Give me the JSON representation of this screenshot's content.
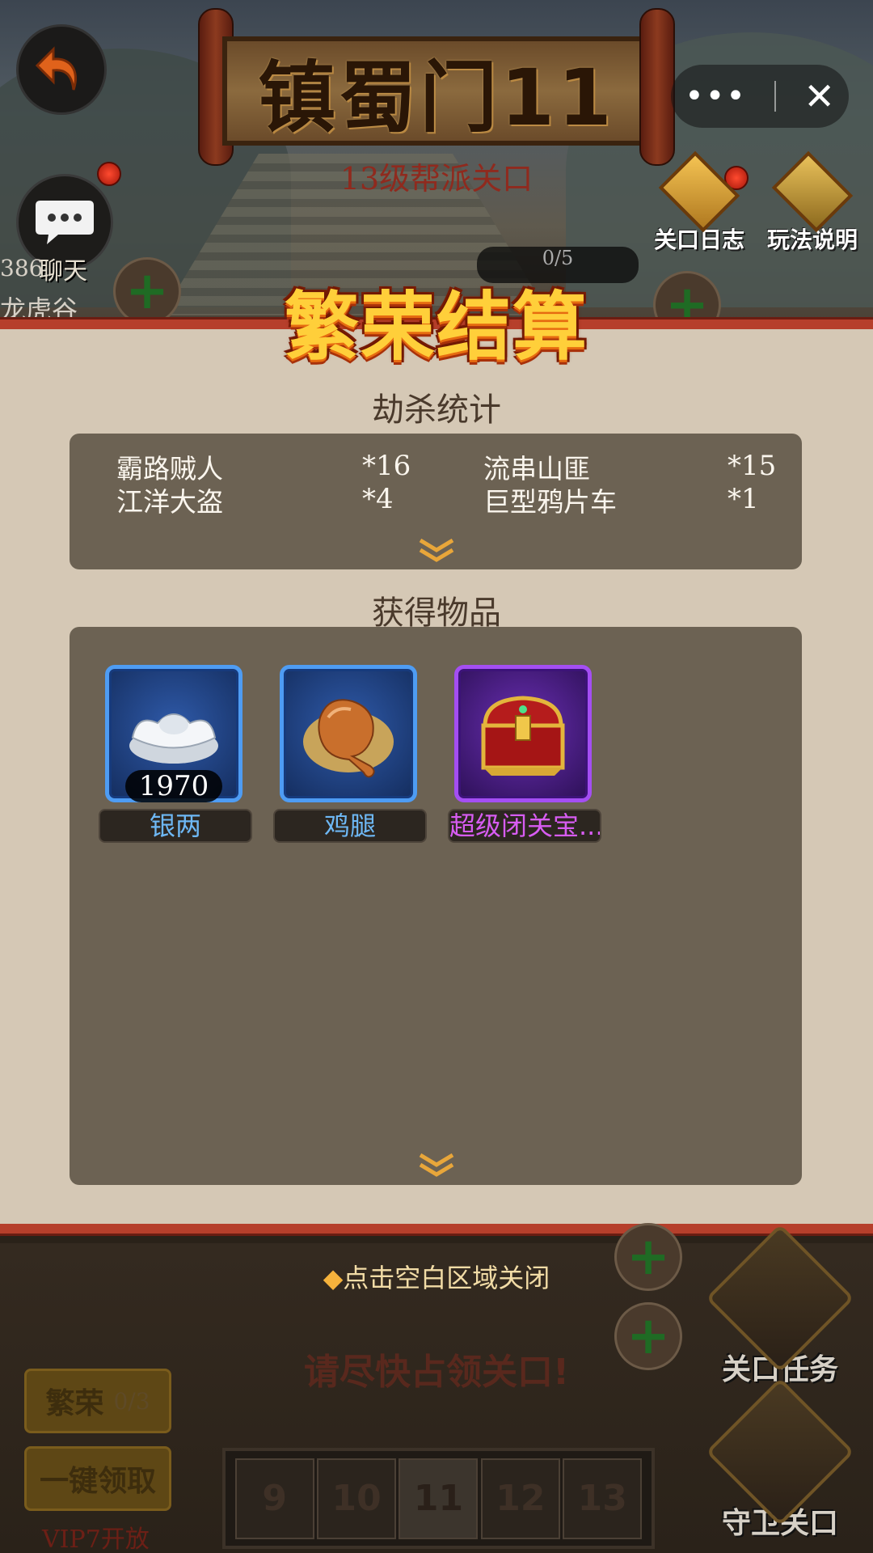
{
  "header": {
    "title": "镇蜀门11",
    "subtitle": "13级帮派关口",
    "chat_label": "聊天",
    "level_log_label": "关口日志",
    "rules_label": "玩法说明",
    "progress": "0/5",
    "left_tag": "386",
    "left_place": "龙虎谷"
  },
  "capsule": {
    "more": "•••",
    "close": "✕"
  },
  "dialog": {
    "title": "繁荣结算",
    "kill_section": {
      "title": "劫杀统计",
      "entries": [
        {
          "name": "霸路贼人",
          "count": "*16"
        },
        {
          "name": "流串山匪",
          "count": "*15"
        },
        {
          "name": "江洋大盗",
          "count": "*4"
        },
        {
          "name": "巨型鸦片车",
          "count": "*1"
        }
      ]
    },
    "items_section": {
      "title": "获得物品",
      "items": [
        {
          "name": "银两",
          "qty": "1970",
          "rarity": "blue",
          "icon": "silver-ingot-icon",
          "name_color": "#6eb8f5"
        },
        {
          "name": "鸡腿",
          "qty": "",
          "rarity": "blue",
          "icon": "chicken-leg-icon",
          "name_color": "#6eb8f5"
        },
        {
          "name": "超级闭关宝...",
          "qty": "",
          "rarity": "purple",
          "icon": "treasure-chest-icon",
          "name_color": "#d75cf2"
        }
      ]
    }
  },
  "footer": {
    "close_hint": "点击空白区域关闭",
    "occupy_text": "请尽快占领关口!",
    "prosperity_label": "繁荣",
    "prosperity_value": "0/3",
    "claim_all_label": "一键领取",
    "vip_text": "VIP7开放",
    "levels": [
      "9",
      "10",
      "11",
      "12",
      "13"
    ],
    "active_level": "11",
    "task_label": "关口任务",
    "defend_label": "守卫关口"
  },
  "colors": {
    "dialog_bg": "#d5c8b5",
    "panel_bg": "#6c6253",
    "border_red": "#b63f2b",
    "title_gold": "#ffcf3a"
  }
}
